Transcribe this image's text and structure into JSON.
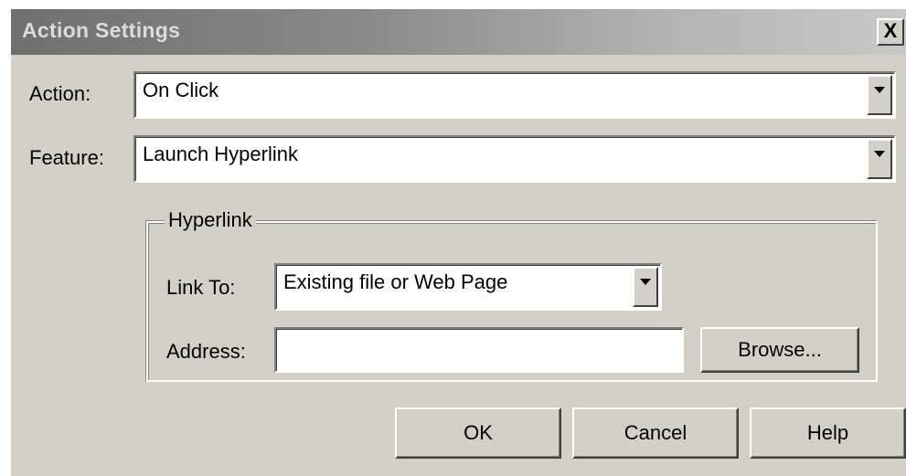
{
  "window": {
    "title": "Action Settings",
    "close_glyph": "X"
  },
  "action": {
    "label": "Action:",
    "value": "On Click"
  },
  "feature": {
    "label": "Feature:",
    "value": "Launch Hyperlink"
  },
  "hyperlink_group": {
    "legend": "Hyperlink",
    "link_to": {
      "label": "Link To:",
      "value": "Existing file or Web Page"
    },
    "address": {
      "label": "Address:",
      "value": ""
    },
    "browse_label": "Browse..."
  },
  "buttons": {
    "ok": "OK",
    "cancel": "Cancel",
    "help": "Help"
  },
  "colors": {
    "dialog_bg": "#d4d0c8",
    "title_gradient_start": "#6f6f6f",
    "title_gradient_end": "#c8c8c8"
  }
}
